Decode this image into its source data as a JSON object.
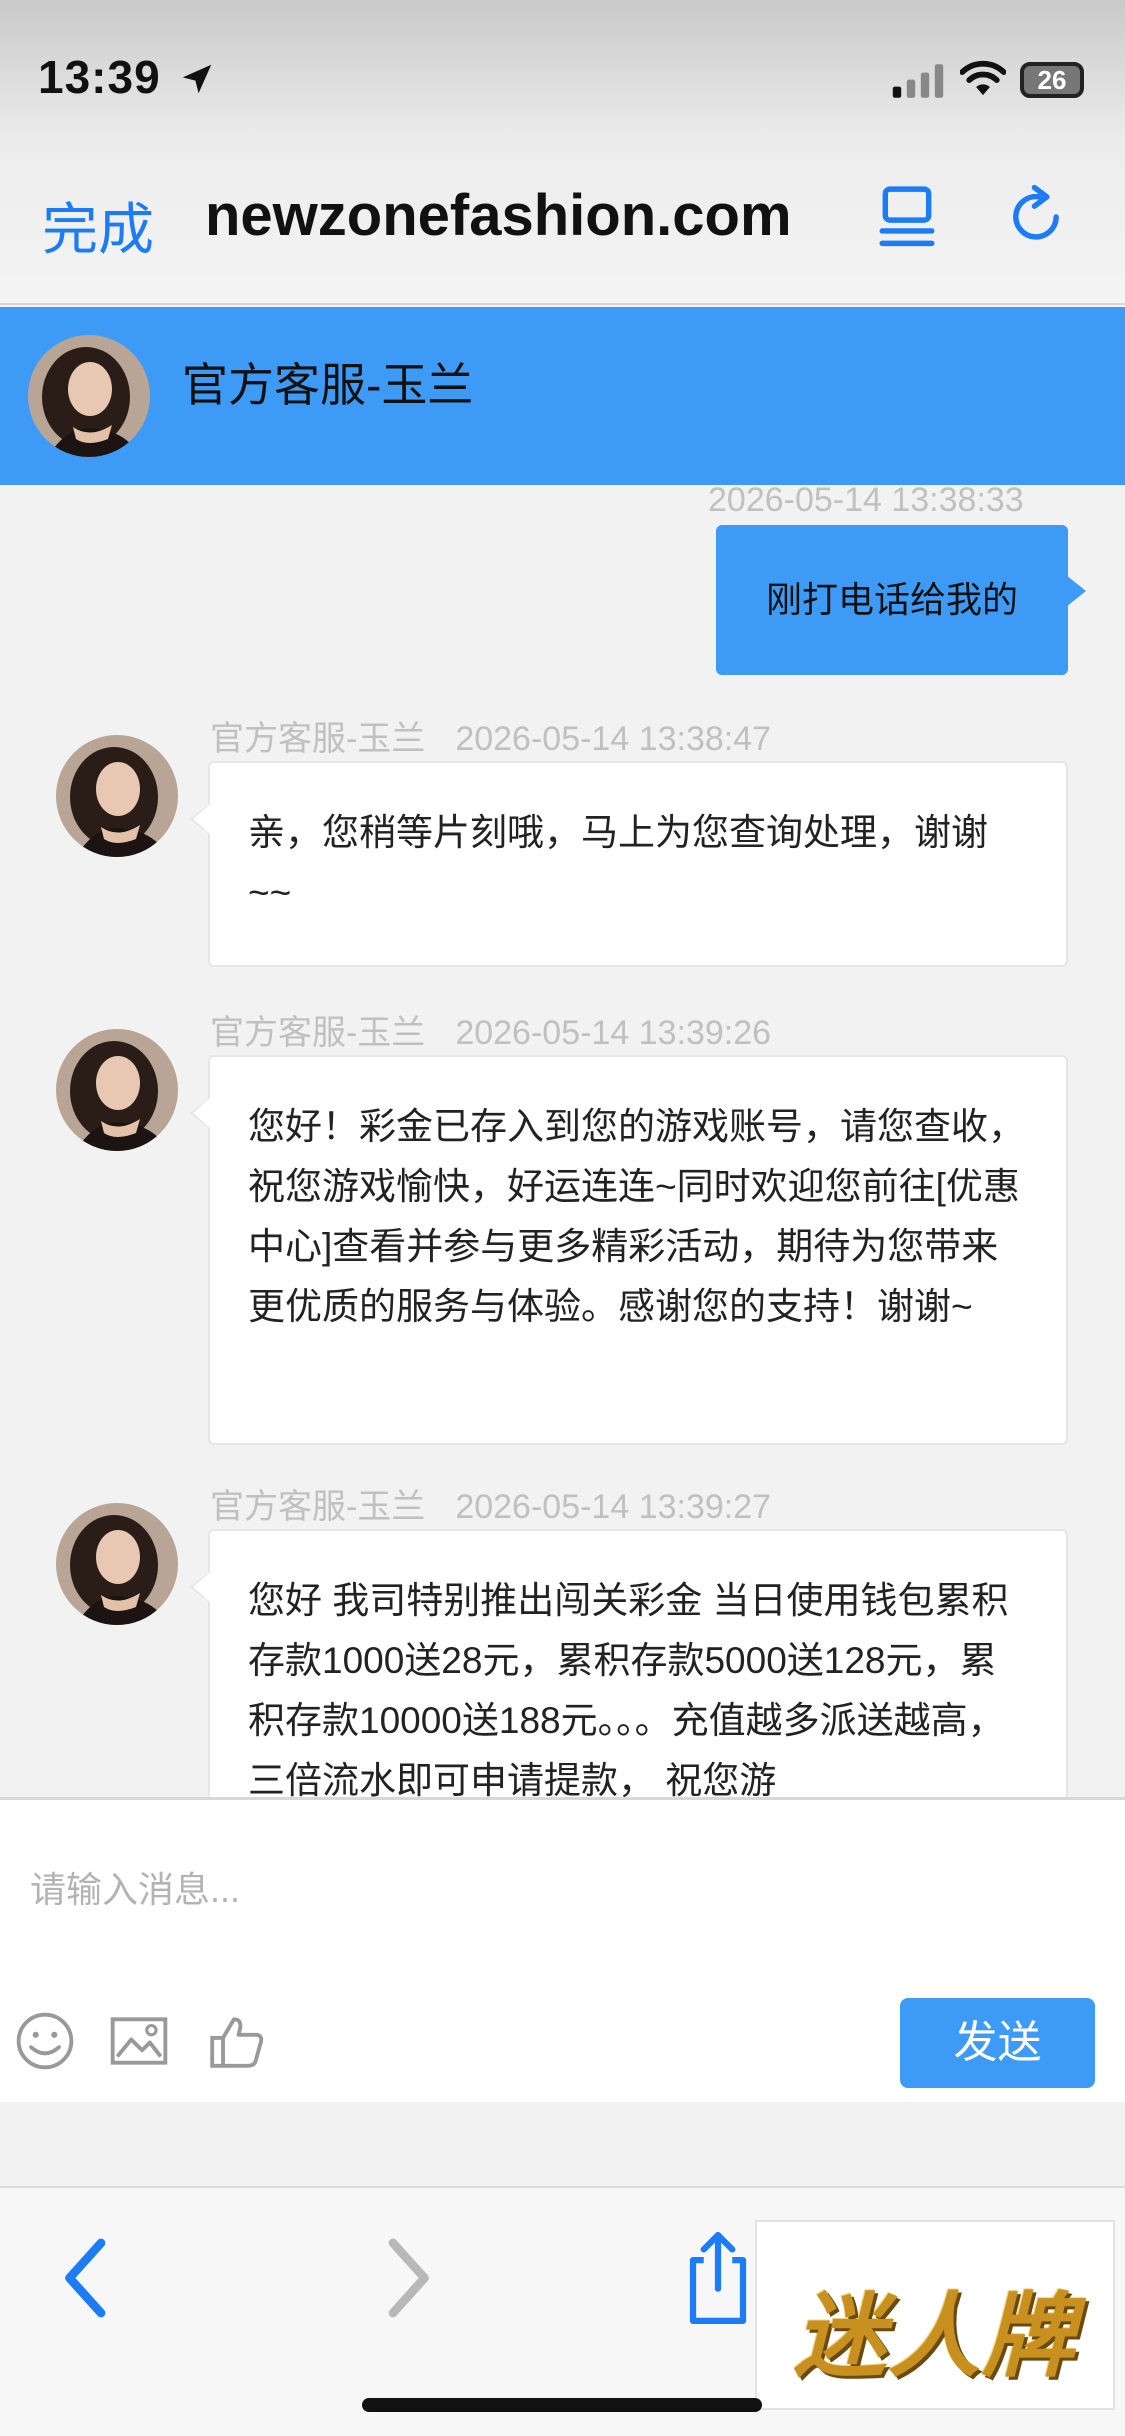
{
  "status_bar": {
    "time": "13:39",
    "battery": "26"
  },
  "browser": {
    "done_label": "完成",
    "url": "newzonefashion.com"
  },
  "chat": {
    "agent_name": "官方客服-玉兰",
    "messages": [
      {
        "from": "user",
        "timestamp": "2026-05-14 13:38:33",
        "text": "刚打电话给我的"
      },
      {
        "from": "agent",
        "sender": "官方客服-玉兰",
        "timestamp": "2026-05-14 13:38:47",
        "text": "亲，您稍等片刻哦，马上为您查询处理，谢谢~~"
      },
      {
        "from": "agent",
        "sender": "官方客服-玉兰",
        "timestamp": "2026-05-14 13:39:26",
        "text": "您好！彩金已存入到您的游戏账号，请您查收，祝您游戏愉快，好运连连~同时欢迎您前往[优惠中心]查看并参与更多精彩活动，期待为您带来更优质的服务与体验。感谢您的支持！谢谢~"
      },
      {
        "from": "agent",
        "sender": "官方客服-玉兰",
        "timestamp": "2026-05-14 13:39:27",
        "text": "您好 我司特别推出闯关彩金 当日使用钱包累积存款1000送28元，累积存款5000送128元，累积存款10000送188元。。。充值越多派送越高，三倍流水即可申请提款， 祝您游"
      }
    ]
  },
  "composer": {
    "placeholder": "请输入消息...",
    "send_label": "发送"
  },
  "ad": {
    "text": "迷人牌"
  },
  "colors": {
    "accent": "#3d9af5",
    "link": "#1b7cf5",
    "ad_gold": "#c8901f"
  },
  "icons": [
    "location-arrow-icon",
    "signal-icon",
    "wifi-icon",
    "reader-icon",
    "reload-icon",
    "emoji-icon",
    "image-icon",
    "thumbs-up-icon",
    "back-icon",
    "forward-icon",
    "share-icon"
  ]
}
